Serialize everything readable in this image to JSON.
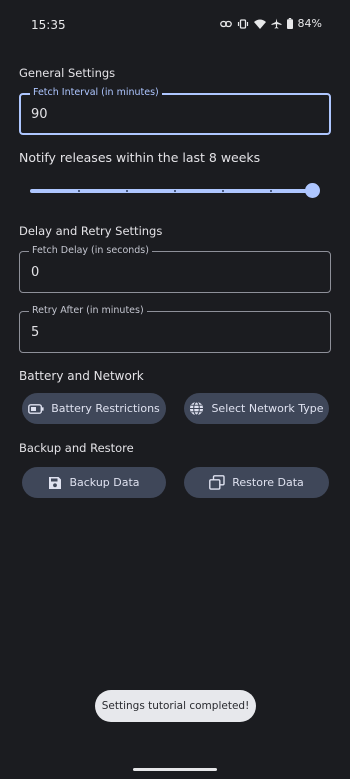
{
  "status_bar": {
    "time": "15:35",
    "battery_percent": "84%"
  },
  "general_settings": {
    "title": "General Settings",
    "fetch_interval": {
      "label": "Fetch Interval (in minutes)",
      "value": "90"
    },
    "notify_label": "Notify releases within the last 8 weeks",
    "notify_weeks_value": 8
  },
  "delay_retry": {
    "title": "Delay and Retry Settings",
    "fetch_delay": {
      "label": "Fetch Delay (in seconds)",
      "value": "0"
    },
    "retry_after": {
      "label": "Retry After (in minutes)",
      "value": "5"
    }
  },
  "battery_network": {
    "title": "Battery and Network",
    "battery_button": "Battery Restrictions",
    "network_button": "Select Network Type"
  },
  "backup_restore": {
    "title": "Backup and Restore",
    "backup_button": "Backup Data",
    "restore_button": "Restore Data"
  },
  "toast": {
    "text": "Settings tutorial completed!"
  },
  "colors": {
    "accent": "#aec6ff",
    "background": "#1b1c20",
    "button": "#3f4759",
    "toast": "#e7e8ec"
  }
}
